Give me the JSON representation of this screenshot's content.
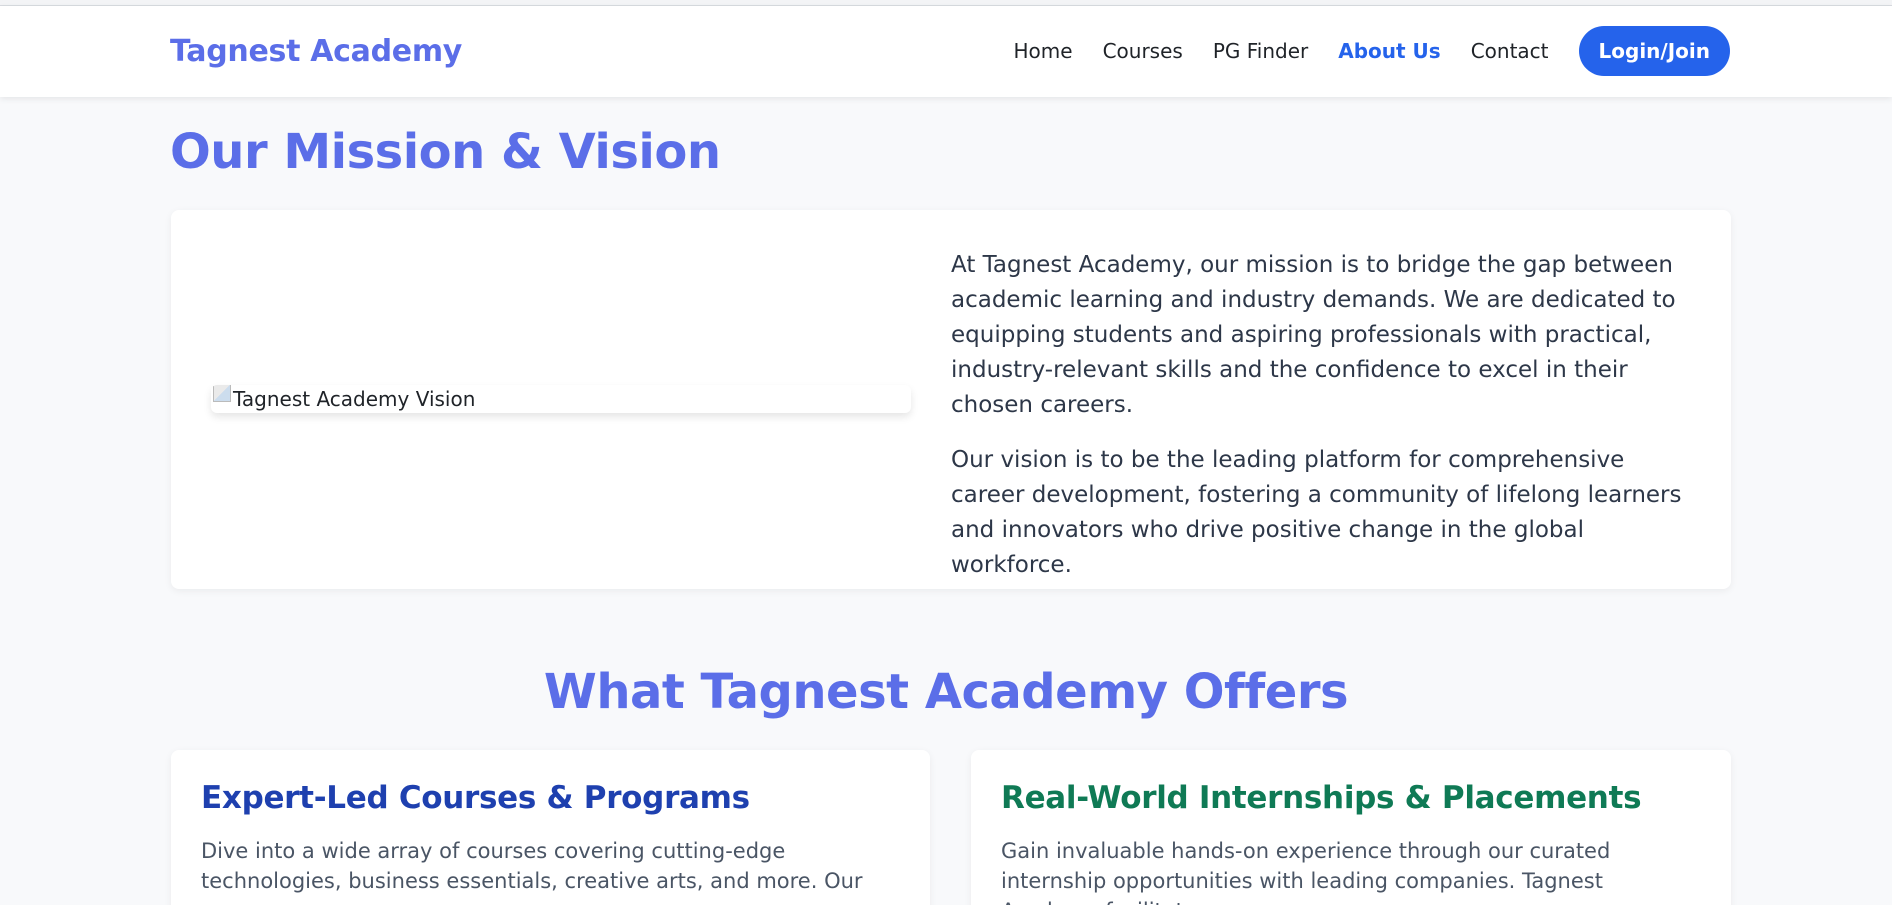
{
  "header": {
    "brand": "Tagnest Academy",
    "nav": {
      "home": "Home",
      "courses": "Courses",
      "pg_finder": "PG Finder",
      "about": "About Us",
      "contact": "Contact"
    },
    "login_label": "Login/Join"
  },
  "mission": {
    "title": "Our Mission & Vision",
    "image_alt": "Tagnest Academy Vision",
    "paragraph1": "At Tagnest Academy, our mission is to bridge the gap between academic learning and industry demands. We are dedicated to equipping students and aspiring professionals with practical, industry-relevant skills and the confidence to excel in their chosen careers.",
    "paragraph2": "Our vision is to be the leading platform for comprehensive career development, fostering a community of lifelong learners and innovators who drive positive change in the global workforce."
  },
  "offers": {
    "title": "What Tagnest Academy Offers",
    "cards": [
      {
        "title": "Expert-Led Courses & Programs",
        "text": "Dive into a wide array of courses covering cutting-edge technologies, business essentials, creative arts, and more. Our"
      },
      {
        "title": "Real-World Internships & Placements",
        "text": "Gain invaluable hands-on experience through our curated internship opportunities with leading companies. Tagnest Academy facilitates"
      }
    ]
  },
  "colors": {
    "brand": "#5b6ee8",
    "accent": "#2563eb",
    "card1_title": "#1e40af",
    "card2_title": "#0f7a55"
  }
}
